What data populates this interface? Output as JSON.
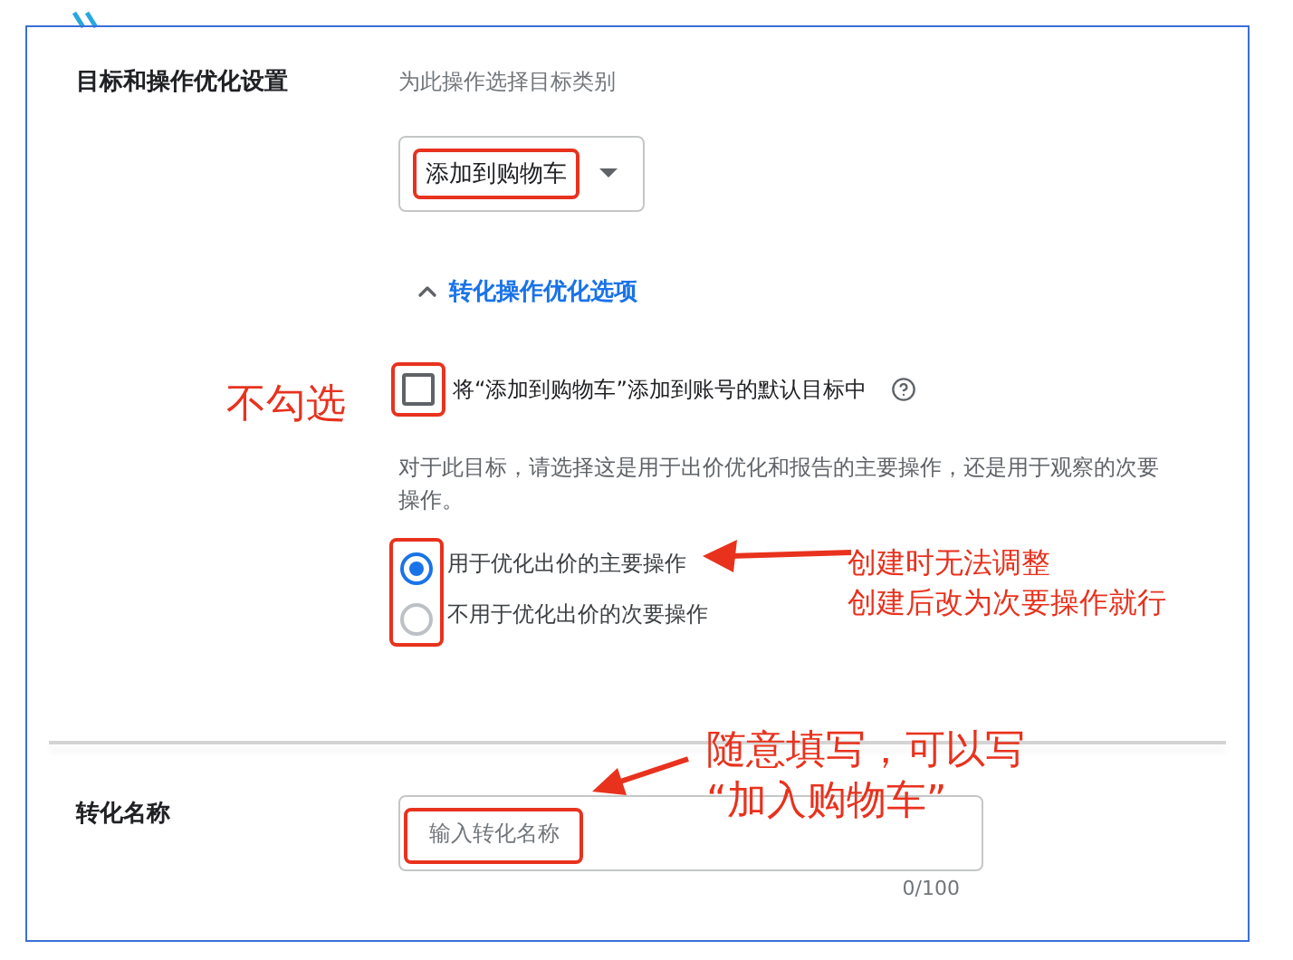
{
  "goal_section": {
    "label": "目标和操作优化设置",
    "hint": "为此操作选择目标类别",
    "goal_select": {
      "value": "添加到购物车"
    },
    "options_link": {
      "label": "转化操作优化选项",
      "expanded": true
    },
    "default_goal_checkbox": {
      "label": "将“添加到购物车”添加到账号的默认目标中",
      "checked": false
    },
    "description": "对于此目标，请选择这是用于出价优化和报告的主要操作，还是用于观察的次要操作。",
    "action_radios": [
      {
        "label": "用于优化出价的主要操作",
        "selected": true
      },
      {
        "label": "不用于优化出价的次要操作",
        "selected": false
      }
    ]
  },
  "conversion_name": {
    "label": "转化名称",
    "input": {
      "placeholder": "输入转化名称"
    },
    "counter": "0/100"
  },
  "annotations": [
    {
      "lines": [
        "不勾选"
      ]
    },
    {
      "lines": [
        "创建时无法调整",
        "创建后改为次要操作就行"
      ]
    },
    {
      "lines": [
        "随意填写，可以写",
        "“加入购物车”"
      ]
    }
  ]
}
